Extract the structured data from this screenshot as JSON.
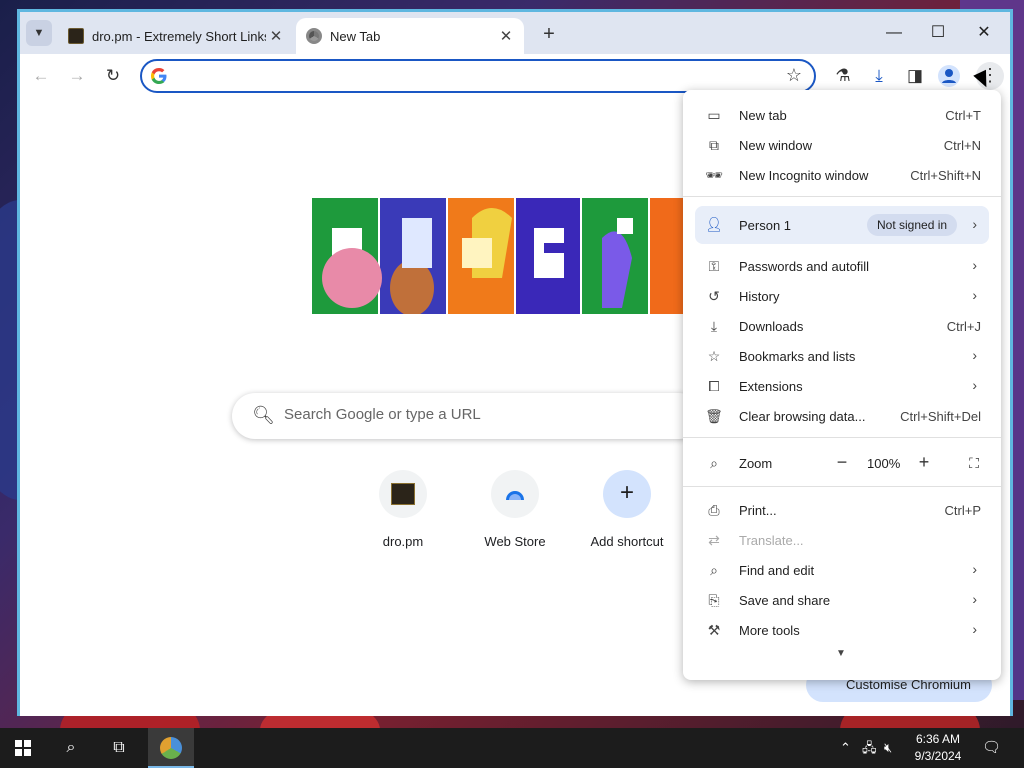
{
  "tabs": [
    {
      "title": "dro.pm - Extremely Short Links",
      "active": false
    },
    {
      "title": "New Tab",
      "active": true
    }
  ],
  "window_controls": {
    "minimize": "—",
    "maximize": "☐",
    "close": "✕"
  },
  "omnibox": {
    "value": "",
    "placeholder": ""
  },
  "new_tab_page": {
    "search_placeholder": "Search Google or type a URL",
    "shortcuts": [
      {
        "label": "dro.pm"
      },
      {
        "label": "Web Store"
      },
      {
        "label": "Add shortcut"
      }
    ],
    "customise_label": "Customise Chromium"
  },
  "menu": {
    "new_tab": {
      "label": "New tab",
      "shortcut": "Ctrl+T"
    },
    "new_window": {
      "label": "New window",
      "shortcut": "Ctrl+N"
    },
    "new_incognito": {
      "label": "New Incognito window",
      "shortcut": "Ctrl+Shift+N"
    },
    "person": {
      "label": "Person 1",
      "badge": "Not signed in"
    },
    "passwords": {
      "label": "Passwords and autofill"
    },
    "history": {
      "label": "History"
    },
    "downloads": {
      "label": "Downloads",
      "shortcut": "Ctrl+J"
    },
    "bookmarks": {
      "label": "Bookmarks and lists"
    },
    "extensions": {
      "label": "Extensions"
    },
    "clear_data": {
      "label": "Clear browsing data...",
      "shortcut": "Ctrl+Shift+Del"
    },
    "zoom": {
      "label": "Zoom",
      "value": "100%"
    },
    "print": {
      "label": "Print...",
      "shortcut": "Ctrl+P"
    },
    "translate": {
      "label": "Translate..."
    },
    "find_edit": {
      "label": "Find and edit"
    },
    "save_share": {
      "label": "Save and share"
    },
    "more_tools": {
      "label": "More tools"
    }
  },
  "taskbar": {
    "time": "6:36 AM",
    "date": "9/3/2024"
  },
  "colors": {
    "accent": "#1a57c4",
    "window_border": "#5fb7e0",
    "tabstrip": "#dfe5f1"
  }
}
